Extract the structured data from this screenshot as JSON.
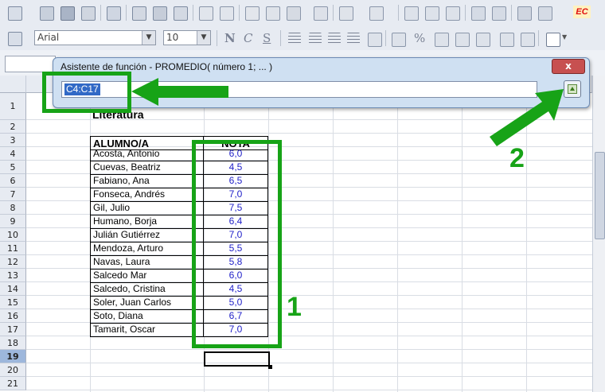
{
  "toolbar": {
    "font_name": "Arial",
    "font_size": "10"
  },
  "dialog": {
    "title": "Asistente de función - PROMEDIO( número 1; ... )",
    "input_value": "C4:C17",
    "close_label": "x"
  },
  "sheet": {
    "row_numbers": [
      "1",
      "2",
      "3",
      "4",
      "5",
      "6",
      "7",
      "8",
      "9",
      "10",
      "11",
      "12",
      "13",
      "14",
      "15",
      "16",
      "17",
      "18",
      "19",
      "20",
      "21"
    ],
    "active_row": "19",
    "title_cell": "Literatura",
    "header_name": "ALUMNO/A",
    "header_grade": "NOTA",
    "rows": [
      {
        "name": "Acosta, Antonio",
        "grade": "6,0"
      },
      {
        "name": "Cuevas, Beatriz",
        "grade": "4,5"
      },
      {
        "name": "Fabiano, Ana",
        "grade": "6,5"
      },
      {
        "name": "Fonseca, Andrés",
        "grade": "7,0"
      },
      {
        "name": "Gil, Julio",
        "grade": "7,5"
      },
      {
        "name": "Humano, Borja",
        "grade": "6,4"
      },
      {
        "name": "Julián Gutiérrez",
        "grade": "7,0"
      },
      {
        "name": "Mendoza, Arturo",
        "grade": "5,5"
      },
      {
        "name": "Navas, Laura",
        "grade": "5,8"
      },
      {
        "name": "Salcedo Mar",
        "grade": "6,0"
      },
      {
        "name": "Salcedo, Cristina",
        "grade": "4,5"
      },
      {
        "name": "Soler, Juan Carlos",
        "grade": "5,0"
      },
      {
        "name": "Soto, Diana",
        "grade": "6,7"
      },
      {
        "name": "Tamarit, Oscar",
        "grade": "7,0"
      }
    ]
  },
  "annotations": {
    "label_1": "1",
    "label_2": "2",
    "color": "#17a317"
  },
  "corner_badge": "EC"
}
